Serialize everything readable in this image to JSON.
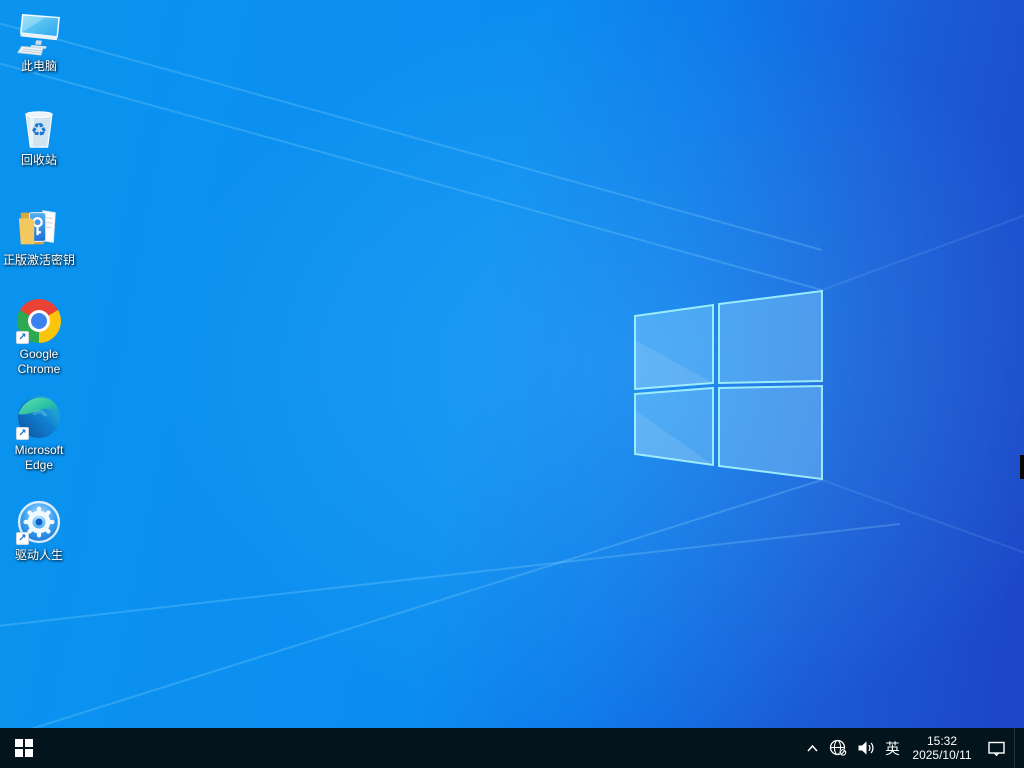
{
  "wallpaper": {
    "base_left_color": "#0a93ef",
    "base_right_color": "#1c47c7",
    "logo_pane_fill": "rgba(150,220,255,0.38)",
    "logo_pane_stroke": "rgba(165,245,255,0.9)"
  },
  "desktop": {
    "icons": [
      {
        "id": "this-pc",
        "label": "此电脑",
        "shortcut": false
      },
      {
        "id": "recycle-bin",
        "label": "回收站",
        "shortcut": false
      },
      {
        "id": "activation-key",
        "label": "正版激活密钥",
        "shortcut": false
      },
      {
        "id": "google-chrome",
        "label": "Google Chrome",
        "shortcut": true
      },
      {
        "id": "microsoft-edge",
        "label": "Microsoft Edge",
        "shortcut": true
      },
      {
        "id": "driver-talent",
        "label": "驱动人生",
        "shortcut": true
      }
    ]
  },
  "taskbar": {
    "tray": {
      "ime_indicator": "英",
      "time": "15:32",
      "date": "2025/10/11"
    }
  },
  "icons": {
    "shortcut_arrow_glyph": "↗",
    "recycle_glyph": "♻"
  }
}
